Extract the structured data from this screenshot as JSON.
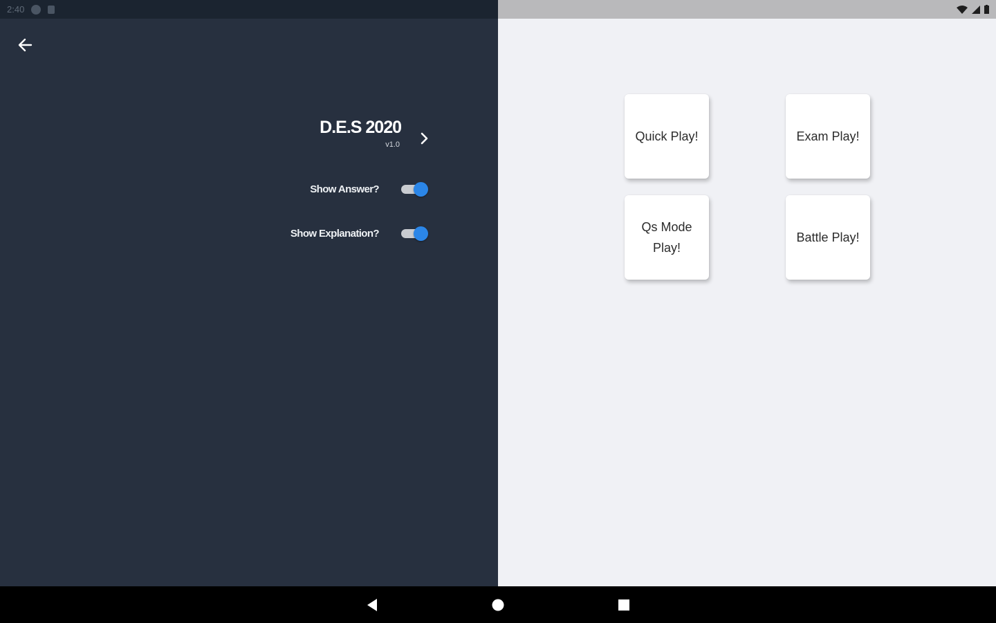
{
  "status_bar": {
    "time": "2:40"
  },
  "settings": {
    "app_name": "D.E.S 2020",
    "version": "v1.0",
    "show_answer_label": "Show Answer?",
    "show_answer_enabled": true,
    "show_explanation_label": "Show Explanation?",
    "show_explanation_enabled": true
  },
  "modes": {
    "quick_play": "Quick Play!",
    "exam_play": "Exam Play!",
    "qs_mode_play": "Qs Mode Play!",
    "battle_play": "Battle Play!"
  },
  "colors": {
    "left_pane_bg": "#27303f",
    "right_pane_bg": "#f0f1f5",
    "toggle_accent": "#2b86e8"
  },
  "icons": {
    "back": "arrow-left-icon",
    "next": "chevron-right-icon",
    "nav_back": "triangle-back-icon",
    "nav_home": "circle-home-icon",
    "nav_recents": "square-recents-icon"
  }
}
